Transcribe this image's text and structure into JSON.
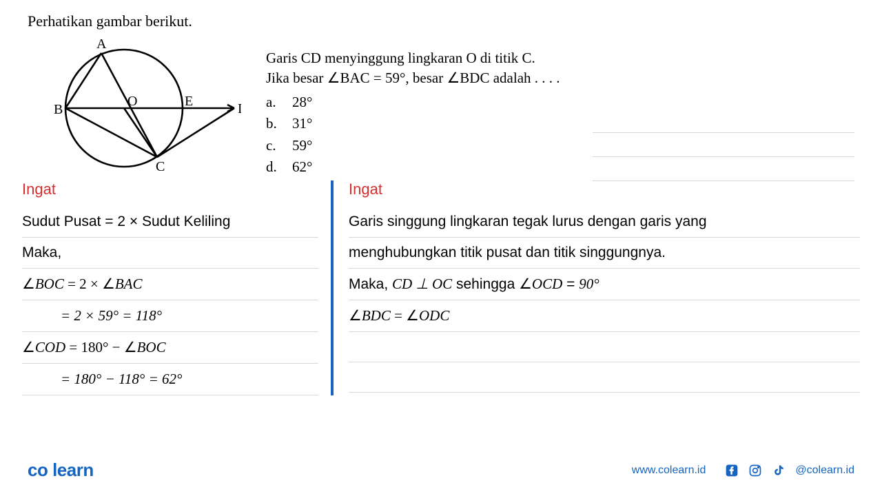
{
  "header": "Perhatikan gambar berikut.",
  "diagram": {
    "labels": {
      "A": "A",
      "B": "B",
      "C": "C",
      "D": "D",
      "E": "E",
      "O": "O"
    }
  },
  "question": {
    "line1": "Garis CD menyinggung lingkaran O di titik C.",
    "line2_pre": "Jika besar ",
    "line2_angle1": "∠BAC = 59°",
    "line2_mid": ", besar ",
    "line2_angle2": "∠BDC",
    "line2_post": " adalah . . . .",
    "options": {
      "a": {
        "l": "a.",
        "v": "28°"
      },
      "b": {
        "l": "b.",
        "v": "31°"
      },
      "c": {
        "l": "c.",
        "v": "59°"
      },
      "d": {
        "l": "d.",
        "v": "62°"
      }
    }
  },
  "left": {
    "ingat": "Ingat",
    "l1": "Sudut Pusat = 2 × Sudut Keliling",
    "l2": "Maka,",
    "l3_pre": "∠",
    "l3_v": "BOC",
    "l3_mid": " = 2 × ∠",
    "l3_v2": "BAC",
    "l4": "= 2 × 59° = 118°",
    "l5_pre": "∠",
    "l5_v": "COD",
    "l5_mid": " = 180° − ∠",
    "l5_v2": "BOC",
    "l6": "= 180° − 118° =  62°"
  },
  "right": {
    "ingat": "Ingat",
    "l1": "Garis singgung lingkaran tegak lurus dengan garis yang",
    "l2": "menghubungkan titik pusat dan titik singgungnya.",
    "l3_pre": "Maka, ",
    "l3_cd": "CD ⊥ OC",
    "l3_mid": " sehingga ∠",
    "l3_v": "OCD",
    "l3_eq": " =  ",
    "l3_hand": "90°",
    "l4_pre": "∠",
    "l4_v1": "BDC",
    "l4_mid": " = ∠",
    "l4_v2": "ODC"
  },
  "footer": {
    "brand_pre": "co",
    "brand_dot": " ",
    "brand_post": "learn",
    "web": "www.colearn.id",
    "handle": "@colearn.id"
  },
  "chart_data": {
    "type": "diagram",
    "shape": "circle with inscribed triangle and tangent",
    "points": [
      "A",
      "B",
      "C",
      "D",
      "E",
      "O"
    ],
    "center": "O",
    "tangent": "CD tangent at C",
    "chord": "BE through O extended to D",
    "known": {
      "angle_BAC_deg": 59
    },
    "derived": {
      "angle_BOC_deg": 118,
      "angle_COD_deg": 62,
      "angle_OCD_deg": 90
    }
  }
}
